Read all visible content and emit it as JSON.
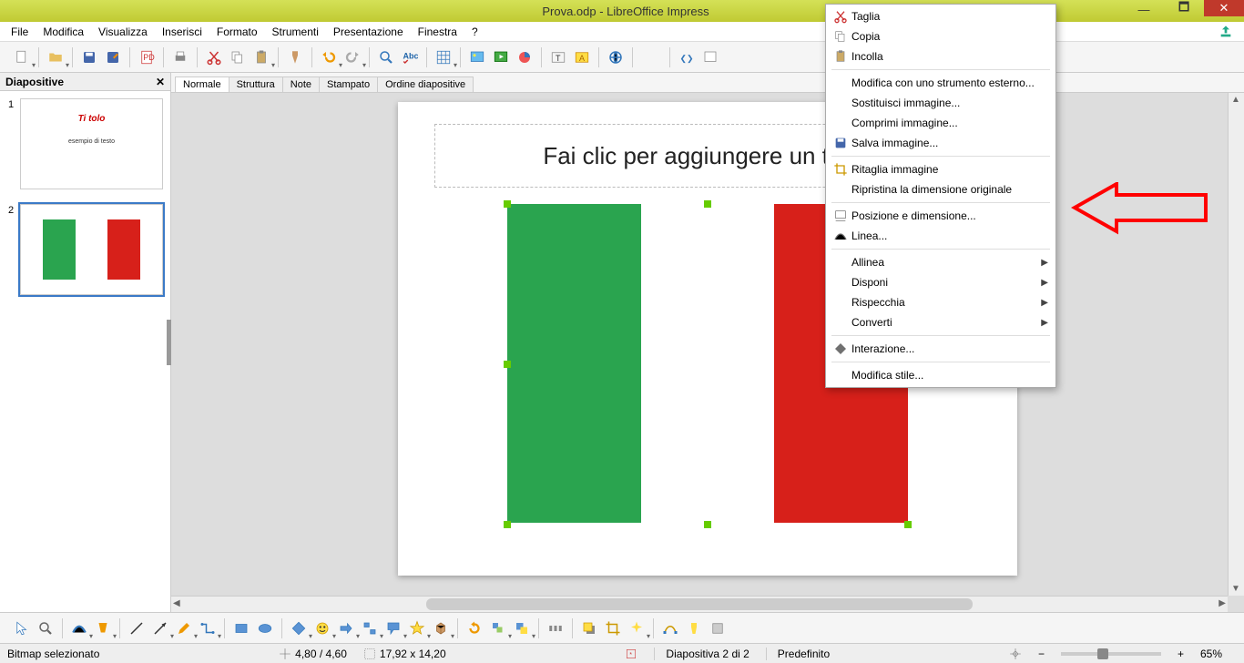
{
  "title": "Prova.odp - LibreOffice Impress",
  "menus": [
    "File",
    "Modifica",
    "Visualizza",
    "Inserisci",
    "Formato",
    "Strumenti",
    "Presentazione",
    "Finestra",
    "?"
  ],
  "panel_title": "Diapositive",
  "slide1": {
    "title": "Ti tolo",
    "subtitle": "esempio di testo"
  },
  "view_tabs": [
    "Normale",
    "Struttura",
    "Note",
    "Stampato",
    "Ordine diapositive"
  ],
  "title_placeholder": "Fai clic per aggiungere un titolo",
  "ctx": {
    "cut": "Taglia",
    "copy": "Copia",
    "paste": "Incolla",
    "edit_ext": "Modifica con uno strumento esterno...",
    "replace_img": "Sostituisci immagine...",
    "compress_img": "Comprimi immagine...",
    "save_img": "Salva immagine...",
    "crop_img": "Ritaglia immagine",
    "reset_orig": "Ripristina la dimensione originale",
    "pos_dim": "Posizione e dimensione...",
    "line": "Linea...",
    "align": "Allinea",
    "arrange": "Disponi",
    "mirror": "Rispecchia",
    "convert": "Converti",
    "interaction": "Interazione...",
    "edit_style": "Modifica stile..."
  },
  "status": {
    "sel": "Bitmap selezionato",
    "pos": "4,80 / 4,60",
    "size": "17,92 x 14,20",
    "slide_of": "Diapositiva 2 di 2",
    "layout": "Predefinito",
    "zoom": "65%"
  }
}
